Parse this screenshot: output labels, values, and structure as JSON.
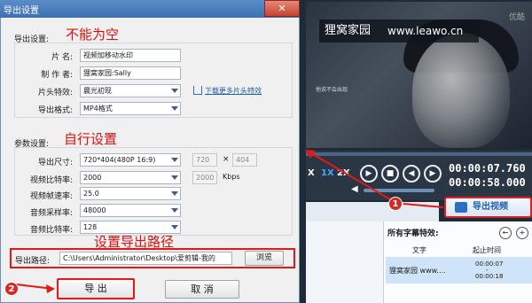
{
  "dialog": {
    "title": "导出设置",
    "close_label": "✕",
    "export_settings": {
      "group_label": "导出设置:",
      "annotation": "不能为空",
      "title_label": "片    名:",
      "title_value": "视频加移动水印",
      "author_label": "制 作 者:",
      "author_value": "狸窝家园:Sally",
      "intro_label": "片头特效:",
      "intro_value": "晨光初现",
      "download_link": "下载更多片头特效",
      "format_label": "导出格式:",
      "format_value": "MP4格式"
    },
    "params": {
      "group_label": "参数设置:",
      "annotation": "自行设置",
      "size_label": "导出尺寸:",
      "size_value": "720*404(480P 16:9)",
      "width_value": "720",
      "times": "×",
      "height_value": "404",
      "vbitrate_label": "视频比特率:",
      "vbitrate_value": "2000",
      "vbitrate_box": "2000",
      "kbps": "Kbps",
      "framerate_label": "视频帧速率:",
      "framerate_value": "25.0",
      "samplerate_label": "音频采样率:",
      "samplerate_value": "48000",
      "abitrate_label": "音频比特率:",
      "abitrate_value": "128"
    },
    "path": {
      "annotation": "设置导出路径",
      "label": "导出路径:",
      "value": "C:\\Users\\Administrator\\Desktop\\爱剪辑-我的",
      "browse_label": "浏览"
    },
    "export_label": "导 出",
    "cancel_label": "取 消",
    "badge1": "1",
    "badge2": "2"
  },
  "player": {
    "watermark_cn": "狸窝家园",
    "watermark_url": "www.leawo.cn",
    "optimize_label": "优酷",
    "small_subtitle": "他说不会出现",
    "speed_1x": "1X",
    "speed_2x": "2X",
    "speed_slow": "X",
    "time_current": "00:00:07.760",
    "time_total": "00:00:58.000",
    "export_video_label": "导出视频"
  },
  "subtitles": {
    "title": "所有字幕特效:",
    "col_text": "文字",
    "col_start": "起止时间",
    "row_text": "狸窝家园 www....",
    "row_start": "00:00:07",
    "row_dash": "-",
    "row_end": "00:00:18"
  },
  "colors": {
    "annotation_red": "#e01010",
    "accent_blue": "#3f70b0"
  }
}
